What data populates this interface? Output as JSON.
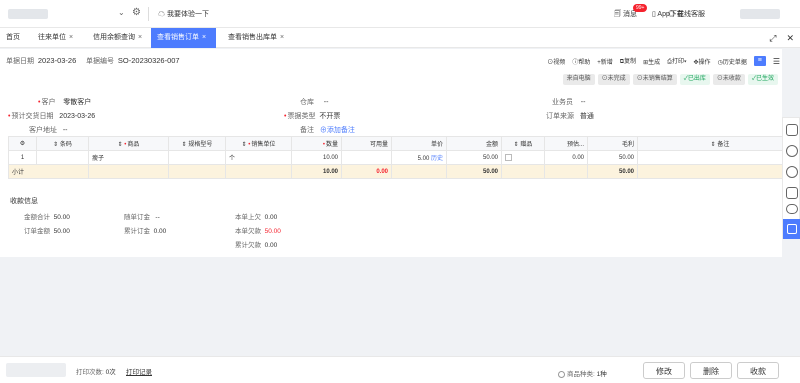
{
  "topbar": {
    "try_new": "我要体验一下",
    "messages_label": "消息",
    "messages_badge": "99+",
    "app_download": "App下载",
    "customer_service": "在线客服"
  },
  "tabs": [
    {
      "label": "首页"
    },
    {
      "label": "往来单位"
    },
    {
      "label": "信用余额查询"
    },
    {
      "label": "查看销售订单"
    },
    {
      "label": "查看销售出库单"
    }
  ],
  "header": {
    "date_label": "单据日期",
    "date_value": "2023-03-26",
    "no_label": "单据编号",
    "no_value": "SO-20230326-007"
  },
  "toolbar": {
    "video": "视频",
    "help": "帮助",
    "add": "新增",
    "copy": "复制",
    "generate": "生成",
    "print": "打印",
    "operate": "操作",
    "history": "历史单据"
  },
  "statuses": [
    "来自电脑",
    "未完成",
    "未销售结算",
    "已出库",
    "未收款",
    "已生效"
  ],
  "form": {
    "customer_label": "客户",
    "customer_value": "零散客户",
    "warehouse_label": "仓库",
    "warehouse_value": "--",
    "salesman_label": "业务员",
    "salesman_value": "--",
    "delivery_label": "预计交货日期",
    "delivery_value": "2023-03-26",
    "invoice_label": "票据类型",
    "invoice_value": "不开票",
    "source_label": "订单来源",
    "source_value": "普通",
    "address_label": "客户地址",
    "address_value": "--",
    "remark_label": "备注",
    "remark_value": "添加备注"
  },
  "table": {
    "headers": [
      "条码",
      "商品",
      "规格型号",
      "销售单位",
      "数量",
      "可用量",
      "单价",
      "金额",
      "赠品",
      "预估...",
      "毛利",
      "备注"
    ],
    "rows": [
      {
        "no": "1",
        "barcode": "",
        "product": "瘦子",
        "spec": "",
        "unit": "个",
        "qty": "10.00",
        "avail": "",
        "price": "5.00",
        "history": "历史",
        "amount": "50.00",
        "est": "0.00",
        "profit": "50.00",
        "remark": ""
      }
    ],
    "subtotal": {
      "label": "小计",
      "qty": "10.00",
      "avail": "0.00",
      "amount": "50.00",
      "profit": "50.00"
    }
  },
  "payment": {
    "title": "收款信息",
    "total_label": "金额合计",
    "total_value": "50.00",
    "order_amount_label": "订单金额",
    "order_amount_value": "50.00",
    "deposit_label": "随单订金",
    "deposit_value": "--",
    "accum_deposit_label": "累计订金",
    "accum_deposit_value": "0.00",
    "last_owed_label": "本单上欠",
    "last_owed_value": "0.00",
    "owed_label": "本单欠款",
    "owed_value": "50.00",
    "accum_owed_label": "累计欠款",
    "accum_owed_value": "0.00"
  },
  "footer": {
    "print_count_label": "打印次数:",
    "print_count_value": "0次",
    "print_record": "打印记录",
    "goods_types_label": "商品种类:",
    "goods_types_value": "1种",
    "edit": "修改",
    "delete": "删除",
    "collect": "收款"
  }
}
